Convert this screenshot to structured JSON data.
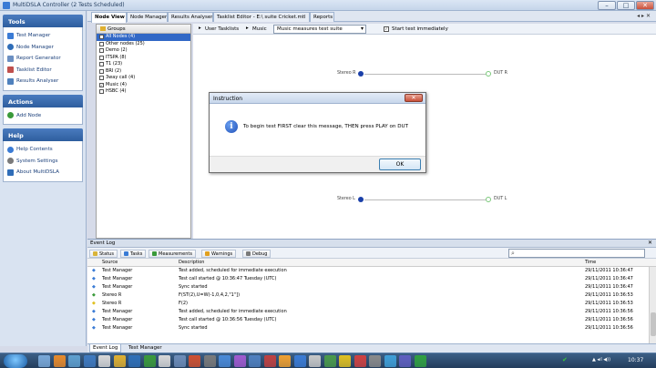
{
  "window": {
    "title": "MultiDSLA Controller (2 Tests Scheduled)",
    "min_glyph": "–",
    "max_glyph": "□",
    "close_glyph": "✕"
  },
  "sidebar": {
    "tools": {
      "header": "Tools",
      "items": [
        {
          "label": "Test Manager",
          "icon": "test-manager-icon",
          "color": "#3a7bd5"
        },
        {
          "label": "Node Manager",
          "icon": "node-manager-icon",
          "color": "#2f6db8"
        },
        {
          "label": "Report Generator",
          "icon": "report-icon",
          "color": "#6b8fc2"
        },
        {
          "label": "Tasklist Editor",
          "icon": "tasklist-icon",
          "color": "#c0504d"
        },
        {
          "label": "Results Analyser",
          "icon": "results-icon",
          "color": "#4f81bd"
        }
      ]
    },
    "actions": {
      "header": "Actions",
      "items": [
        {
          "label": "Add Node",
          "icon": "add-node-icon",
          "color": "#3a9a3a"
        }
      ]
    },
    "help": {
      "header": "Help",
      "items": [
        {
          "label": "Help Contents",
          "icon": "help-icon",
          "color": "#3a7bd5"
        },
        {
          "label": "System Settings",
          "icon": "settings-icon",
          "color": "#7a7a7a"
        },
        {
          "label": "About MultiDSLA",
          "icon": "about-icon",
          "color": "#2f6db8"
        }
      ]
    }
  },
  "tabs": [
    {
      "label": "Node View",
      "active": true
    },
    {
      "label": "Node Manager",
      "active": false
    },
    {
      "label": "Results Analyser",
      "active": false
    },
    {
      "label": "Tasklist Editor - E:\\ suite Cricket.mtl",
      "active": false
    },
    {
      "label": "Reports",
      "active": false
    }
  ],
  "tab_controls": "◂ ▸ ✕",
  "groups": {
    "header": "Groups",
    "items": [
      {
        "label": "All Nodes (4)",
        "selected": true,
        "checked": false
      },
      {
        "label": "Other nodes (25)",
        "selected": false,
        "checked": false
      },
      {
        "label": "Demo (2)",
        "selected": false,
        "checked": false
      },
      {
        "label": "ITSPA (8)",
        "selected": false,
        "checked": false
      },
      {
        "label": "T1 (23)",
        "selected": false,
        "checked": false
      },
      {
        "label": "BRI (2)",
        "selected": false,
        "checked": false
      },
      {
        "label": "3way call (4)",
        "selected": false,
        "checked": false
      },
      {
        "label": "Music (4)",
        "selected": false,
        "checked": true
      },
      {
        "label": "HSBC (4)",
        "selected": false,
        "checked": false
      }
    ]
  },
  "toolbar": {
    "tasklist_label": "User Tasklists",
    "separator": "▸",
    "music_label": "Music",
    "dropdown_value": "Music measures test suite",
    "dropdown_arrow": "▾",
    "start_immediately_label": "Start test immediately",
    "start_immediately_checked": true
  },
  "nodes": {
    "stereo_r": "Stereo R",
    "dut_r": "DUT R",
    "stereo_l": "Stereo L",
    "dut_l": "DUT L"
  },
  "dialog": {
    "title": "Instruction",
    "message": "To begin test FIRST clear this message, THEN press PLAY on DUT",
    "ok_label": "OK",
    "close_glyph": "✕",
    "info_glyph": "i"
  },
  "event_log": {
    "title": "Event Log",
    "buttons": [
      {
        "label": "Status",
        "color": "#d9b43a"
      },
      {
        "label": "Tasks",
        "color": "#3a7bd5"
      },
      {
        "label": "Measurements",
        "color": "#3a9a3a"
      },
      {
        "label": "Warnings",
        "color": "#e0a020"
      },
      {
        "label": "Debug",
        "color": "#7a7a7a"
      }
    ],
    "search_glyph": "⌕",
    "columns": {
      "source": "Source",
      "description": "Description",
      "time": "Time"
    },
    "rows": [
      {
        "source": "Test Manager",
        "description": "Test added, scheduled for immediate execution",
        "time": "29/11/2011 10:36:47",
        "color": "#3a7bd5"
      },
      {
        "source": "Test Manager",
        "description": "Test call started @ 10:36:47 Tuesday (UTC)",
        "time": "29/11/2011 10:36:47",
        "color": "#3a7bd5"
      },
      {
        "source": "Test Manager",
        "description": "Sync started",
        "time": "29/11/2011 10:36:47",
        "color": "#3a7bd5"
      },
      {
        "source": "Stereo R",
        "description": "F(ST(2),U=W(-1,0,4,2,\"1\"])",
        "time": "29/11/2011 10:36:53",
        "color": "#3a9a3a"
      },
      {
        "source": "Stereo R",
        "description": "F(2)",
        "time": "29/11/2011 10:36:53",
        "color": "#e0c020"
      },
      {
        "source": "Test Manager",
        "description": "Test added, scheduled for immediate execution",
        "time": "29/11/2011 10:36:56",
        "color": "#3a7bd5"
      },
      {
        "source": "Test Manager",
        "description": "Test call started @ 10:36:56 Tuesday (UTC)",
        "time": "29/11/2011 10:36:56",
        "color": "#3a7bd5"
      },
      {
        "source": "Test Manager",
        "description": "Sync started",
        "time": "29/11/2011 10:36:56",
        "color": "#3a7bd5"
      }
    ],
    "tabs": [
      {
        "label": "Event Log"
      },
      {
        "label": "Test Manager"
      }
    ]
  },
  "taskbar": {
    "clock": "10:37",
    "tray": "▲ ◂ıl ◀))",
    "icons": [
      "#7aa8d8",
      "#e88a2a",
      "#5fa0d0",
      "#3f7ac0",
      "#d8d8d8",
      "#e0b030",
      "#2e6fb8",
      "#3a9a3a",
      "#d8d8d8",
      "#6d8cb8",
      "#d05030",
      "#7a7a7a",
      "#4a8ad8",
      "#a05ad0",
      "#5080c0",
      "#c04040",
      "#f0a030",
      "#3a7bd5",
      "#c8c8c8",
      "#4a9a4a",
      "#e0c020",
      "#d04040",
      "#8a8a8a",
      "#3f9fd8",
      "#5f5fc0",
      "#30a040"
    ],
    "check_glyph": "✔"
  }
}
